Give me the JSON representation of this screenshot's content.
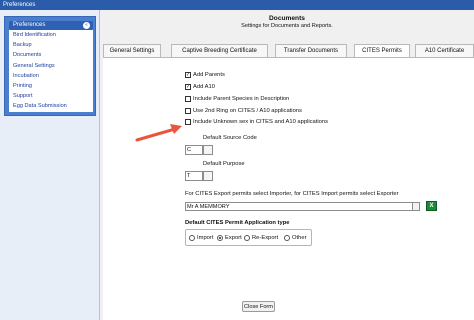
{
  "window": {
    "title": "Preferences"
  },
  "nav": {
    "header": "Preferences",
    "items": [
      "Bird Identification",
      "Backup",
      "Documents",
      "General Settings",
      "Incubation",
      "Printing",
      "Support",
      "Egg Data Submission"
    ]
  },
  "page": {
    "title": "Documents",
    "subtitle": "Settings for Documents and Reports."
  },
  "tabs": [
    "General Settings",
    "Captive Breeding Certificate",
    "Transfer Documents",
    "CITES Permits",
    "A10 Certificate"
  ],
  "active_tab": "CITES Permits",
  "form": {
    "checkboxes": [
      {
        "label": "Add Parents",
        "checked": true
      },
      {
        "label": "Add A10",
        "checked": true
      },
      {
        "label": "Include Parent Species in Description",
        "checked": false
      },
      {
        "label": "Use 2nd  Ring on CITES / A10 applications",
        "checked": false
      },
      {
        "label": "Include Unknown sex in CITES and A10 applications",
        "checked": false
      }
    ],
    "default_source_code_label": "Default Source Code",
    "default_source_code_value": "C",
    "default_purpose_label": "Default Purpose",
    "default_purpose_value": "T",
    "exporter_label": "For CITES Export permits select Importer, for CITES Import permits select Exporter",
    "exporter_value": "Mr A MEMMORY",
    "permit_type_label": "Default CITES Permit Application type",
    "permit_type_options": [
      "Import",
      "Export",
      "Re-Export",
      "Other"
    ],
    "permit_type_selected": "Export",
    "close_button": "Close Form"
  },
  "colors": {
    "titlebar": "#2a5caa",
    "nav_panel": "#4a7fd0",
    "arrow": "#e8563e",
    "excel_icon": "#1d8a3a"
  }
}
